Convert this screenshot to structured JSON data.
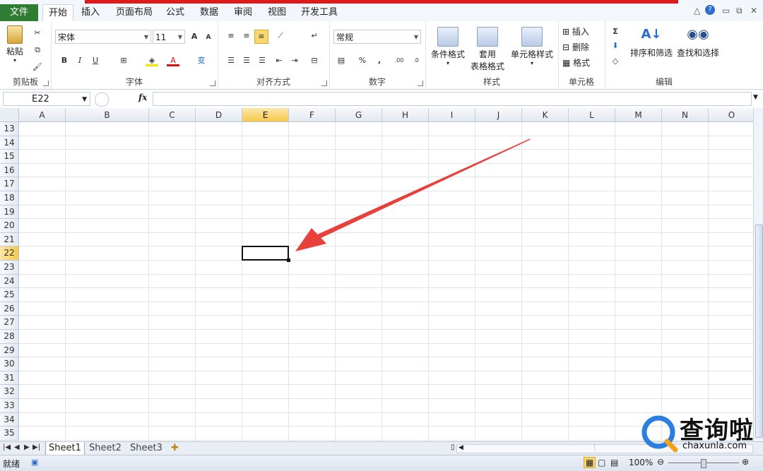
{
  "ribbon_tabs": {
    "file": "文件",
    "home": "开始",
    "insert": "插入",
    "page_layout": "页面布局",
    "formulas": "公式",
    "data": "数据",
    "review": "审阅",
    "view": "视图",
    "developer": "开发工具"
  },
  "clipboard": {
    "paste": "粘贴",
    "group": "剪贴板"
  },
  "font": {
    "name": "宋体",
    "size": "11",
    "group": "字体",
    "bold": "B",
    "italic": "I",
    "underline": "U",
    "grow": "A",
    "shrink": "A",
    "font_color_glyph": "A",
    "phonetic": "变"
  },
  "alignment": {
    "group": "对齐方式"
  },
  "number": {
    "format": "常规",
    "group": "数字",
    "percent": "%",
    "comma": ",",
    "inc_decimal": ".00",
    "dec_decimal": ".0"
  },
  "styles": {
    "conditional": "条件格式",
    "table_line1": "套用",
    "table_line2": "表格格式",
    "cell_styles": "单元格样式",
    "group": "样式"
  },
  "cells": {
    "insert": "插入",
    "delete": "删除",
    "format": "格式",
    "group": "单元格"
  },
  "editing": {
    "sum": "Σ",
    "sort_filter": "排序和筛选",
    "find_select": "查找和选择",
    "group": "编辑"
  },
  "formula_bar": {
    "name_box": "E22",
    "fx": "fx",
    "formula": ""
  },
  "columns": [
    "A",
    "B",
    "C",
    "D",
    "E",
    "F",
    "G",
    "H",
    "I",
    "J",
    "K",
    "L",
    "M",
    "N",
    "O"
  ],
  "rows": [
    "13",
    "14",
    "15",
    "16",
    "17",
    "18",
    "19",
    "20",
    "21",
    "22",
    "23",
    "24",
    "25",
    "26",
    "27",
    "28",
    "29",
    "30",
    "31",
    "32",
    "33",
    "34",
    "35"
  ],
  "selected": {
    "column": "E",
    "row": "22"
  },
  "sheets": [
    "Sheet1",
    "Sheet2",
    "Sheet3"
  ],
  "active_sheet": "Sheet1",
  "status": {
    "ready": "就绪",
    "zoom": "100%"
  },
  "watermark": {
    "brand": "查询啦",
    "domain": "chaxunla.com"
  },
  "colors": {
    "file_tab": "#2f7d32",
    "selection": "#f6c94a",
    "arrow": "#e8413c",
    "top_strip": "#e0191b"
  }
}
